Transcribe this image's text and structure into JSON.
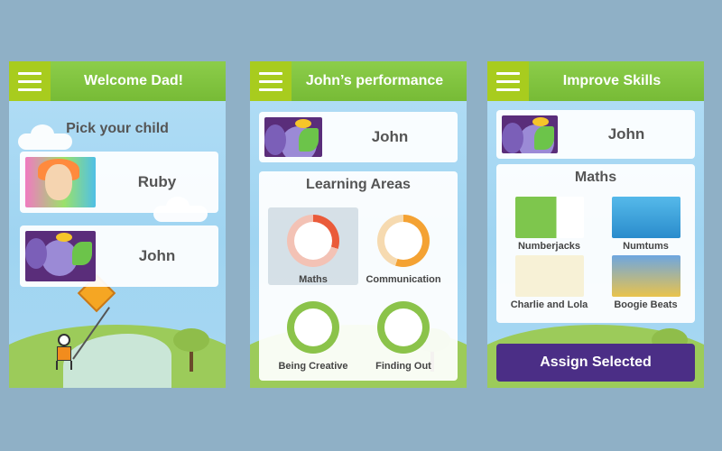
{
  "screens": [
    {
      "title": "Welcome Dad!",
      "heading": "Pick your child",
      "children": [
        {
          "name": "Ruby",
          "thumbnail": "ruby-character-icon"
        },
        {
          "name": "John",
          "thumbnail": "elephant-character-icon"
        }
      ]
    },
    {
      "title": "John’s performance",
      "child": {
        "name": "John",
        "thumbnail": "elephant-character-icon"
      },
      "section_title": "Learning Areas",
      "areas": [
        {
          "label": "Maths",
          "progress_percent": 30,
          "color": "#ea5b3a",
          "selected": true
        },
        {
          "label": "Communication",
          "progress_percent": 55,
          "color": "#f4a233",
          "selected": false
        },
        {
          "label": "Being Creative",
          "progress_percent": 100,
          "color": "#8bc34a",
          "selected": false
        },
        {
          "label": "Finding Out",
          "progress_percent": 100,
          "color": "#8bc34a",
          "selected": false
        }
      ]
    },
    {
      "title": "Improve Skills",
      "child": {
        "name": "John",
        "thumbnail": "elephant-character-icon"
      },
      "section_title": "Maths",
      "games": [
        {
          "label": "Numberjacks"
        },
        {
          "label": "Numtums"
        },
        {
          "label": "Charlie and Lola"
        },
        {
          "label": "Boogie Beats"
        }
      ],
      "assign_label": "Assign Selected"
    }
  ],
  "colors": {
    "header_green": "#7cc13c",
    "menu_button": "#a8cc1e",
    "assign_button": "#4b2e86",
    "background": "#8fb0c6"
  }
}
